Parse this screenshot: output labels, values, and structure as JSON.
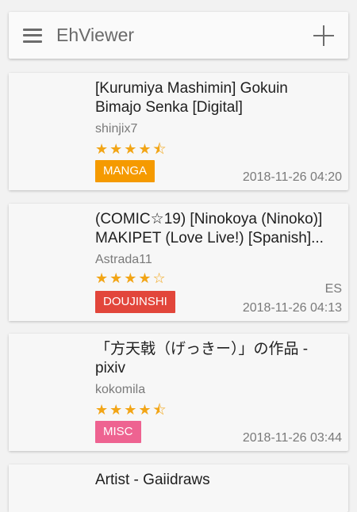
{
  "app": {
    "title": "EhViewer"
  },
  "colors": {
    "star": "#f2a516",
    "manga": "#f59a00",
    "doujinshi": "#e2463b",
    "misc": "#ee6391"
  },
  "galleries": [
    {
      "title_line1": "[Kurumiya Mashimin] Gokuin",
      "title_line2": "Bimajo Senka [Digital]",
      "uploader": "shinjix7",
      "rating": 4.5,
      "stars": "★★★★",
      "category": "MANGA",
      "posted": "2018-11-26 04:20",
      "language": ""
    },
    {
      "title_line1": "(COMIC☆19) [Ninokoya (Ninoko)]",
      "title_line2": "MAKIPET (Love Live!) [Spanish]...",
      "uploader": "Astrada11",
      "rating": 4,
      "stars": "★★★★☆",
      "category": "DOUJINSHI",
      "posted": "2018-11-26 04:13",
      "language": "ES"
    },
    {
      "title_line1": "「方天戟（げっきー）」の作品 -",
      "title_line2": "pixiv",
      "uploader": "kokomila",
      "rating": 4.5,
      "stars": "★★★★",
      "category": "MISC",
      "posted": "2018-11-26 03:44",
      "language": ""
    },
    {
      "title_line1": "Artist - Gaiidraws",
      "title_line2": ""
    }
  ]
}
